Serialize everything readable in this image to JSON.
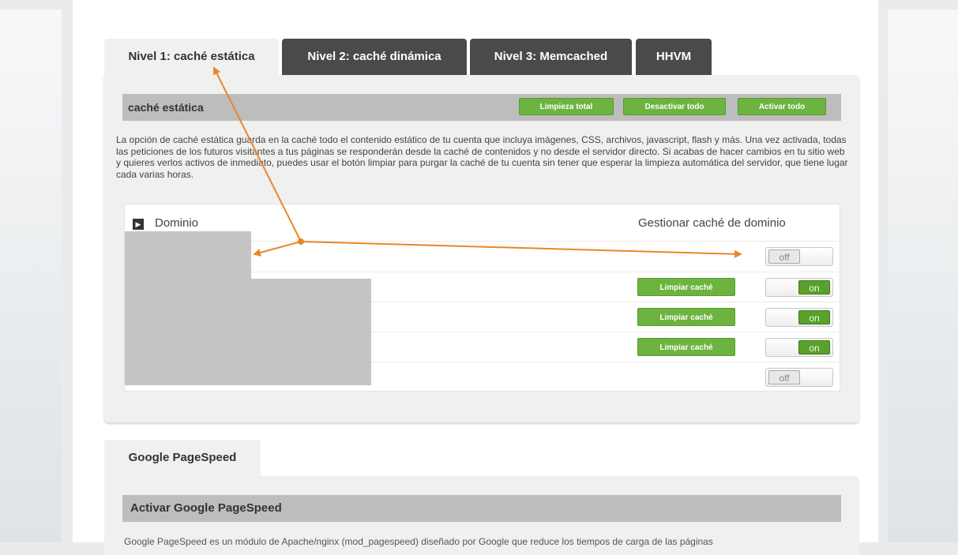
{
  "tabs": [
    {
      "label": "Nivel 1: caché estática",
      "active": true
    },
    {
      "label": "Nivel 2: caché dinámica",
      "active": false
    },
    {
      "label": "Nivel 3: Memcached",
      "active": false
    },
    {
      "label": "HHVM",
      "active": false
    }
  ],
  "static_cache": {
    "title": "caché estática",
    "buttons": {
      "purge_all": "Limpieza total",
      "disable_all": "Desactivar todo",
      "enable_all": "Activar todo"
    },
    "description": "La opción de caché estática guarda en la caché todo el contenido estático de tu cuenta que incluya imágenes, CSS, archivos, javascript, flash y más. Una vez activada, todas las peticiones de los futuros visitantes a tus páginas se responderán desde la caché de contenidos y no desde el servidor directo. Si acabas de hacer cambios en tu sitio web y quieres verlos activos de inmediato, puedes usar el botón limpiar para purgar la caché de tu cuenta sin tener que esperar la limpieza automática del servidor, que tiene lugar cada varias horas.",
    "table": {
      "col_domain": "Dominio",
      "col_manage": "Gestionar caché de dominio",
      "rows": [
        {
          "state": "off",
          "clear_label": ""
        },
        {
          "state": "on",
          "clear_label": "Limpiar caché"
        },
        {
          "state": "on",
          "clear_label": "Limpiar caché"
        },
        {
          "state": "on",
          "clear_label": "Limpiar caché"
        },
        {
          "state": "off",
          "clear_label": ""
        }
      ]
    }
  },
  "pagespeed": {
    "tab_label": "Google PageSpeed",
    "title": "Activar Google PageSpeed",
    "description_visible_fragment": "Google PageSpeed es un módulo de Apache/nginx (mod_pagespeed) diseñado por Google que reduce los tiempos de carga de las páginas"
  },
  "colors": {
    "accent_green": "#6db33f",
    "dark_tab": "#4a4a4a",
    "annotation_orange": "#e8872b"
  }
}
